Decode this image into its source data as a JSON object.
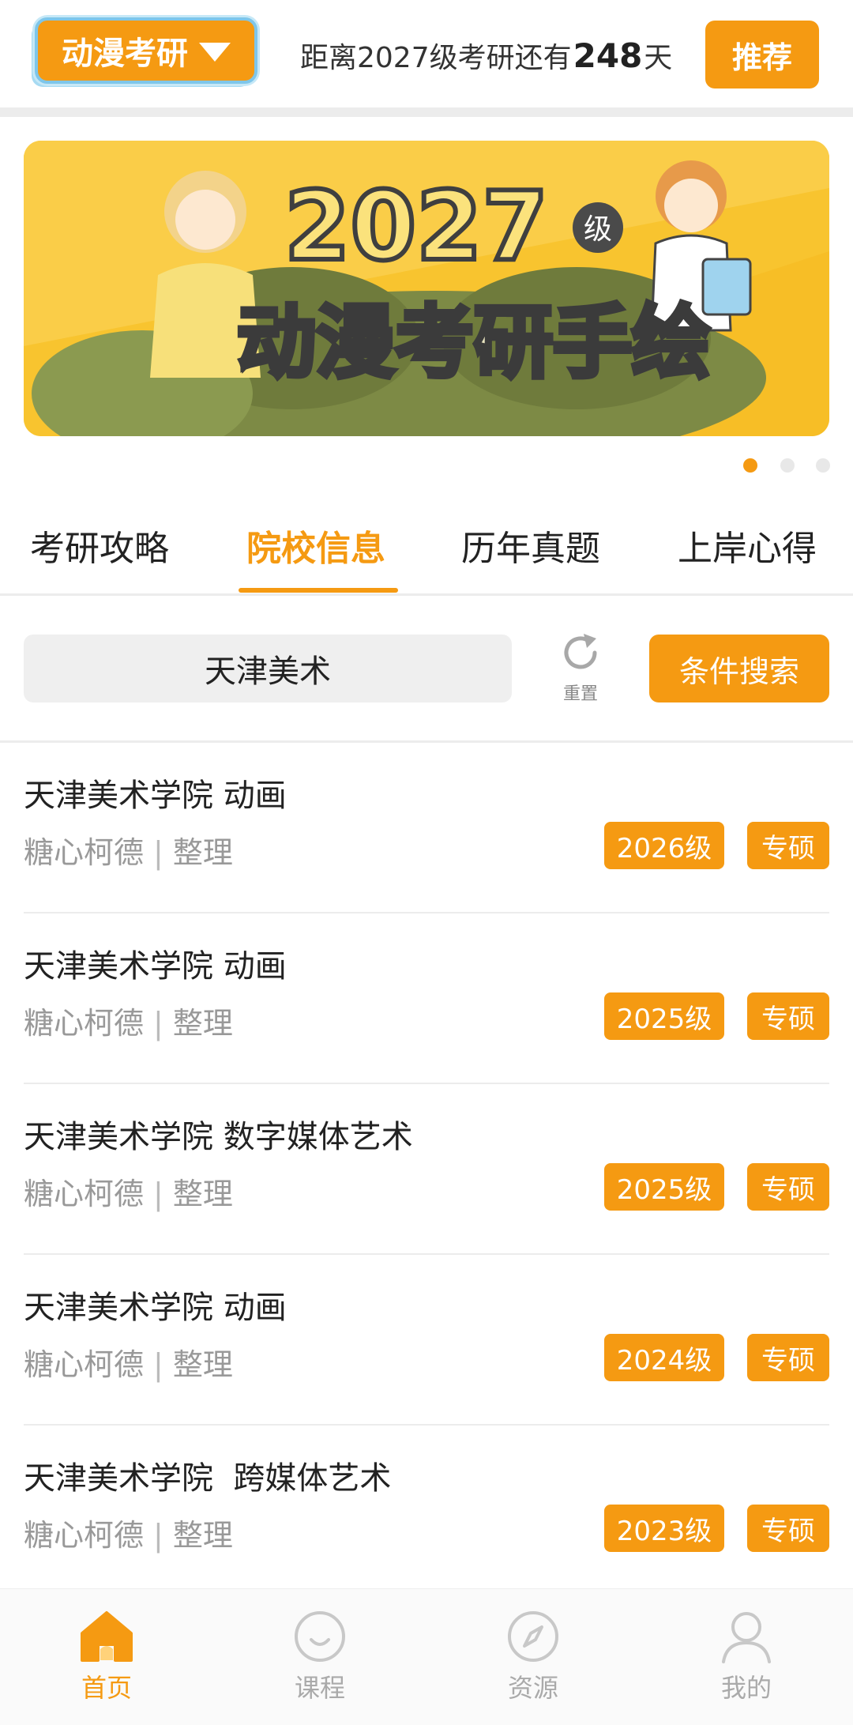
{
  "header": {
    "brand_label": "动漫考研",
    "countdown_prefix": "距离2027级考研还有",
    "countdown_days": "248",
    "countdown_suffix": "天",
    "recommend_label": "推荐"
  },
  "banner": {
    "title_year": "2027",
    "title_badge": "级",
    "title_main": "动漫考研手绘",
    "active_index": 0,
    "count": 3
  },
  "tabs": [
    {
      "label": "考研攻略",
      "active": false
    },
    {
      "label": "院校信息",
      "active": true
    },
    {
      "label": "历年真题",
      "active": false
    },
    {
      "label": "上岸心得",
      "active": false
    }
  ],
  "search": {
    "value": "天津美术",
    "reset_label": "重置",
    "condition_label": "条件搜索"
  },
  "list": [
    {
      "title": "天津美术学院 动画",
      "author": "糖心柯德",
      "sep": "|",
      "role": "整理",
      "year_tag": "2026级",
      "type_tag": "专硕"
    },
    {
      "title": "天津美术学院 动画",
      "author": "糖心柯德",
      "sep": "|",
      "role": "整理",
      "year_tag": "2025级",
      "type_tag": "专硕"
    },
    {
      "title": "天津美术学院 数字媒体艺术",
      "author": "糖心柯德",
      "sep": "|",
      "role": "整理",
      "year_tag": "2025级",
      "type_tag": "专硕"
    },
    {
      "title": "天津美术学院 动画",
      "author": "糖心柯德",
      "sep": "|",
      "role": "整理",
      "year_tag": "2024级",
      "type_tag": "专硕"
    },
    {
      "title": "天津美术学院  跨媒体艺术",
      "author": "糖心柯德",
      "sep": "|",
      "role": "整理",
      "year_tag": "2023级",
      "type_tag": "专硕"
    }
  ],
  "bottom_nav": [
    {
      "label": "首页",
      "icon": "home-icon",
      "active": true
    },
    {
      "label": "课程",
      "icon": "smile-face-icon",
      "active": false
    },
    {
      "label": "资源",
      "icon": "compass-icon",
      "active": false
    },
    {
      "label": "我的",
      "icon": "person-icon",
      "active": false
    }
  ],
  "colors": {
    "accent": "#f59a12",
    "divider": "#ececec",
    "muted_text": "#999999"
  }
}
